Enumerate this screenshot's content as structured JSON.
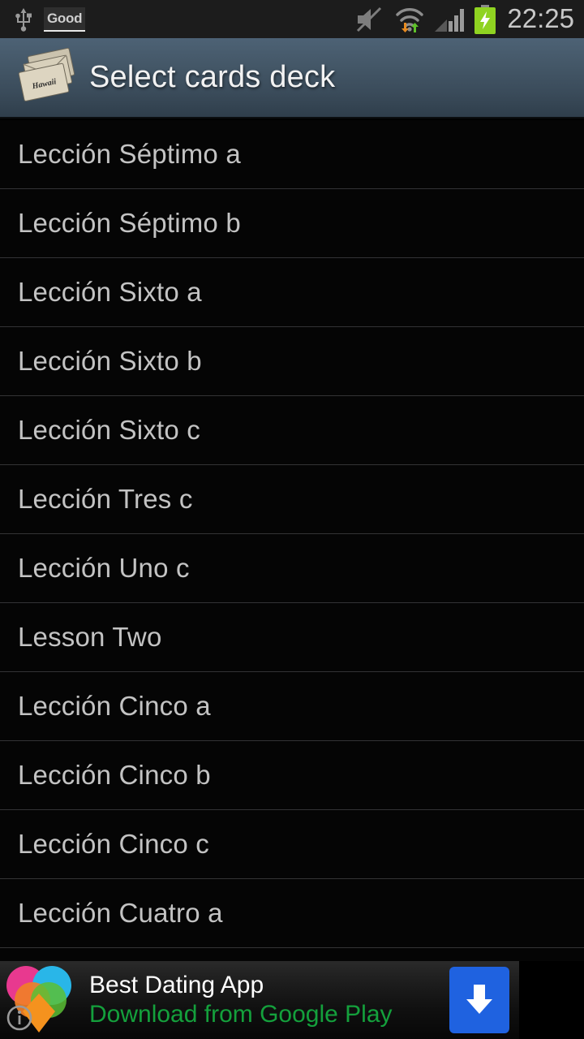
{
  "statusbar": {
    "time": "22:25",
    "notification_badge": "Good",
    "icons": [
      "usb-icon",
      "mute-icon",
      "wifi-icon",
      "signal-icon",
      "battery-charging-icon"
    ],
    "time_color": "#c8c8c8",
    "battery_color": "#8fd321"
  },
  "titlebar": {
    "title": "Select cards deck",
    "icon": "cards-deck-icon",
    "card_label": "Hawaii",
    "gradient_top": "#4d6275",
    "gradient_bottom": "#2f3e4b"
  },
  "list": {
    "items": [
      {
        "label": "Lección Séptimo a"
      },
      {
        "label": "Lección Séptimo b"
      },
      {
        "label": "Lección Sixto a"
      },
      {
        "label": "Lección Sixto b"
      },
      {
        "label": "Lección Sixto c"
      },
      {
        "label": "Lección Tres c"
      },
      {
        "label": "Lección Uno c"
      },
      {
        "label": "Lesson Two"
      },
      {
        "label": "Lección Cinco a"
      },
      {
        "label": "Lección Cinco b"
      },
      {
        "label": "Lección Cinco c"
      },
      {
        "label": "Lección Cuatro a"
      },
      {
        "label": ""
      }
    ]
  },
  "ad": {
    "title": "Best Dating App",
    "subtitle": "Download from Google Play",
    "title_color": "#ffffff",
    "subtitle_color": "#14a03c",
    "cta_color": "#1f62e0",
    "logo": "hearts-logo-icon",
    "cta_icon": "download-arrow-icon",
    "info_icon": "ad-info-icon"
  }
}
